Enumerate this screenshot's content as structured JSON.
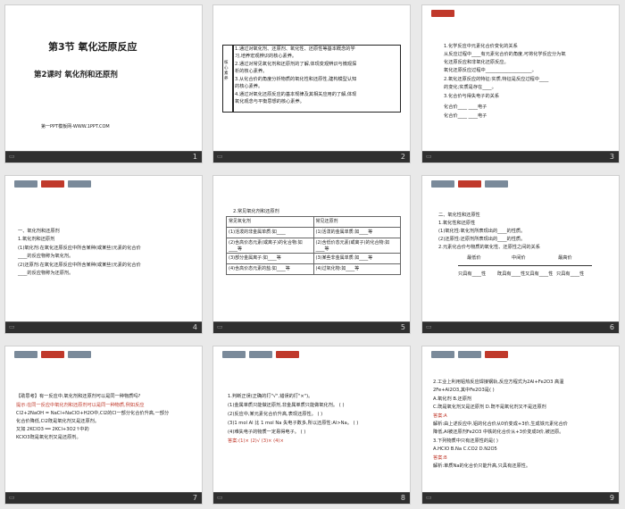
{
  "slides": [
    {
      "num": "1",
      "title": "第3节  氧化还原反应",
      "subtitle": "第2课时    氧化剂和还原剂",
      "footer": "第一PPT模板网-WWW.1PPT.COM"
    },
    {
      "num": "2",
      "side": "核心素养",
      "lines": [
        "1.通过对氧化剂、还原剂、氧化性、还原性等基本概念的学",
        "习,培养宏观辨识的核心素养。",
        "2.通过对常见氧化剂和还原剂的了解,体现变观辨识与微观探",
        "析的核心素养。",
        "3.从化合价的角度分析物质的氧化性和还原性,建构模型认知",
        "的核心素养。",
        "4.通过对氧化还原反应的基本规律及其相关应用的了解,体现",
        "氧化观念与平衡思想的核心素养。"
      ]
    },
    {
      "num": "3",
      "lines": [
        "1.化学反应中元素化合价变化的关系",
        "从反应过程中____有元素化合价的角度,可将化学反应分为氧",
        "化还原反应和非氧化还原反应。",
        "  氧化还原反应过程中____________________。",
        "2.氧化还原反应的特征:实质,特征是反应过程中____",
        "的变化;实质是存在____。",
        "3.化合价与得失电子的关系",
        "化合价____          ____电子",
        "化合价____          ____电子"
      ]
    },
    {
      "num": "4",
      "lines": [
        "一、氧化剂和还原剂",
        "1.氧化剂和还原剂",
        "(1)氧化剂:在氧化还原反应中所含某种(或某些)元素的化合价",
        "____的反应物称为氧化剂。",
        "(2)还原剂:在氧化还原反应中所含某种(或某些)元素的化合价",
        "____的反应物称为还原剂。"
      ]
    },
    {
      "num": "5",
      "caption": "2.常见氧化剂和还原剂",
      "headers": [
        "常见氧化剂",
        "常见还原剂"
      ],
      "rows": [
        [
          "(1)活泼的非金属单质:如____",
          "(1)活泼的金属单质:如____等"
        ],
        [
          "(2)含高价态元素(或离子)的化合物:如____等",
          "(2)含低价态元素(或离子)的化合物:如____等"
        ],
        [
          "(3)部分金属离子:如____等",
          "(3)某些非金属单质:如____等"
        ],
        [
          "(4)含高价态元素的盐:如____等",
          "(4)过氧化物:如____等"
        ]
      ]
    },
    {
      "num": "6",
      "lines": [
        "二、氧化性和还原性",
        "1.氧化性和还原性",
        "(1)氧化性:氧化剂所表现出的____的性质。",
        "(2)还原性:还原剂所表现出的____的性质。",
        "2.元素化合价与物质的氧化性、还原性之间的关系"
      ],
      "scale": [
        "最低价",
        "中间价",
        "最高价"
      ],
      "labels": [
        "只具有____性",
        "既具有____性又具有____性",
        "只具有____性"
      ]
    },
    {
      "num": "7",
      "lines": [
        "【助思考】有一反应中,氧化剂和还原剂可以是同一种物质吗?",
        "提示:在同一反应中氧化剂和还原剂可以是同一种物质,例如反应",
        "Cl2+2NaOH = NaCl+NaClO+H2O中,Cl2的Cl一部分化合价升高,一部分",
        "化合价降低,Cl2既是氧化剂又是还原剂。",
        "又如 2KClO3 ══ 2KCl+3O2↑中的",
        "KClO3既是氧化剂又是还原剂。"
      ]
    },
    {
      "num": "8",
      "lines": [
        "1.判断正误(正确的打\"√\",错误的打\"×\")。",
        "(1)金属单质只能做还原剂,非金属单质只能做氧化剂。  (     )",
        "(2)反应中,某元素化合价升高,表现还原性。  (     )",
        "(3)1 mol Al 比 1 mol Na 失电子数多,所以还原性:Al>Na。  (     )",
        "(4)难失电子的物质一定易得电子。  (     )",
        "答案:(1)×  (2)√  (3)×  (4)×"
      ]
    },
    {
      "num": "9",
      "lines": [
        "2.工业上利用铝热反应焊接钢轨,反应方程式为2Al+Fe2O3  高温",
        "2Fe+Al2O3,其中Fe2O3是(     )",
        "A.氧化剂            B.还原剂",
        "C.既是氧化剂又是还原剂    D.既不是氧化剂又不是还原剂",
        "答案:A",
        "解析:由上述反应中,铝的化合价从0价变成+3价,生成铁元素化合价",
        "降低,Al被还原剂Fe2O3 中铁的化合价从+3价变成0价,被还原。",
        "3.下列物质中只有还原性的是(     )",
        "A.HClO     B.Na     C.CO2     D.N2O5",
        "答案:B",
        "解析:单质Na的化合价只能升高,只具有还原性。"
      ]
    }
  ]
}
